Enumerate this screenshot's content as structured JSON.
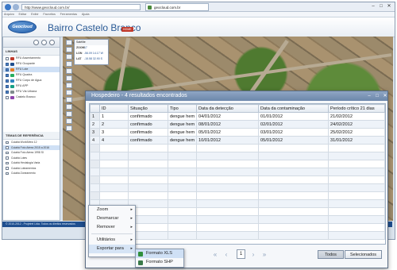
{
  "browser": {
    "address": "http://www.geocloud.com.br/",
    "tab_title": "geocloud.com.br",
    "menu": [
      "Arquivo",
      "Editar",
      "Exibir",
      "Favoritos",
      "Ferramentas",
      "Ajuda"
    ]
  },
  "app": {
    "logo_text": "Geocloud",
    "title": "Bairro Castelo Branco",
    "badge": "HOME"
  },
  "left_panel": {
    "layers_title": "LINHAS",
    "layers": [
      {
        "label": "RFU Assentamento",
        "checked": false,
        "color": "#c0392b"
      },
      {
        "label": "RFU Ocupante",
        "checked": true,
        "color": "#1f4f8f"
      },
      {
        "label": "RFU Lote",
        "checked": true,
        "color": "#e67e22",
        "selected": true
      },
      {
        "label": "RFU Quadra",
        "checked": true,
        "color": "#27ae60"
      },
      {
        "label": "RFU Corpo de Agua",
        "checked": true,
        "color": "#2e86c1"
      },
      {
        "label": "RFU APP",
        "checked": true,
        "color": "#16a085"
      },
      {
        "label": "RFU Via Urbana",
        "checked": true,
        "color": "#7f8c8d"
      },
      {
        "label": "Castelo Branco",
        "checked": false,
        "color": "#8e44ad"
      }
    ],
    "refs_title": "TEMAS DE REFERÊNCIA",
    "refs": [
      {
        "label": "Cuiabá WorldView 12"
      },
      {
        "label": "Cuiabá Foto Aérea 2015 a 2016",
        "selected": true
      },
      {
        "label": "Cuiabá Foto Aérea 1998 SI"
      },
      {
        "label": "Cuiabá Lotes"
      },
      {
        "label": "Cuiabá Hectalogia Varia"
      },
      {
        "label": "Cuiabá Loteamentos"
      },
      {
        "label": "Cuiabá Zoneamento"
      }
    ]
  },
  "coords": {
    "zoom_label": "ZOOM",
    "zoom_value": "17",
    "lon_label": "LON",
    "lon_value": "-56.09 14.17 W",
    "lat_label": "LAT",
    "lat_value": "-15.58 32.90 S",
    "select_value": "Satélite"
  },
  "footer_text": "© 2010-2012 - Projetrel Ltda. Todos os direitos reservados",
  "dialog": {
    "title": "Hospedeiro - 4 resultados encontrados",
    "columns": [
      "ID",
      "Situação",
      "Tipo",
      "Data da detecção",
      "Data da contaminação",
      "Período crítico 21 dias"
    ],
    "rows": [
      {
        "n": "1",
        "id": "1",
        "situacao": "confirmado",
        "tipo": "dengue hem",
        "deteccao": "04/01/2012",
        "contaminacao": "01/01/2012",
        "periodo": "21/02/2012"
      },
      {
        "n": "2",
        "id": "2",
        "situacao": "confirmado",
        "tipo": "dengue hem",
        "deteccao": "08/01/2012",
        "contaminacao": "02/01/2012",
        "periodo": "24/02/2012"
      },
      {
        "n": "3",
        "id": "3",
        "situacao": "confirmado",
        "tipo": "dengue hem",
        "deteccao": "05/01/2012",
        "contaminacao": "03/01/2012",
        "periodo": "25/02/2012"
      },
      {
        "n": "4",
        "id": "4",
        "situacao": "confirmado",
        "tipo": "dengue hem",
        "deteccao": "10/01/2012",
        "contaminacao": "05/01/2012",
        "periodo": "31/01/2012"
      }
    ],
    "page": "1",
    "btn_all": "Todos",
    "btn_selected": "Selecionados"
  },
  "context_menu": {
    "items": [
      {
        "label": "Zoom",
        "arrow": true
      },
      {
        "label": "Desmarcar",
        "arrow": true
      },
      {
        "label": "Remover",
        "arrow": true
      }
    ],
    "items2": [
      {
        "label": "Utilitários",
        "arrow": true
      },
      {
        "label": "Exportar para",
        "arrow": true
      }
    ],
    "submenu": [
      {
        "label": "Formato XLS"
      },
      {
        "label": "Formato SHP"
      }
    ]
  },
  "colors": {
    "accent": "#1f4f8f",
    "dialog_title": "#7a93b6",
    "export_icon": "#2f8f3b"
  }
}
